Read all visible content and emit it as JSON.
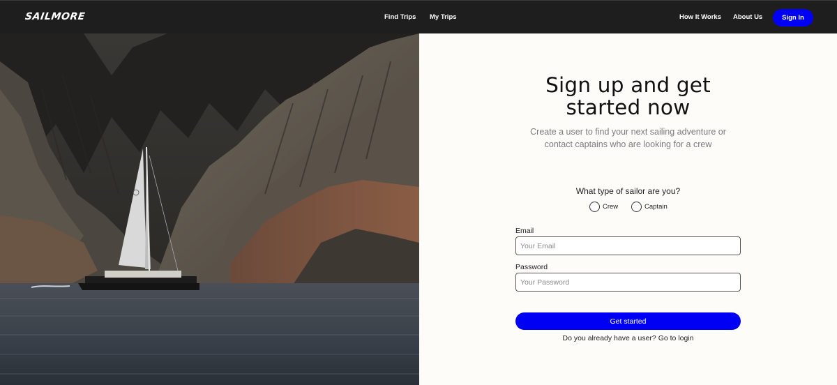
{
  "navbar": {
    "logo": "SAILMORE",
    "links": {
      "find_trips": "Find Trips",
      "my_trips": "My Trips",
      "how_it_works": "How It Works",
      "about_us": "About Us"
    },
    "sign_in": "Sign In"
  },
  "hero": {
    "icon": "sailboat-photo"
  },
  "signup": {
    "heading_line1": "Sign up and get",
    "heading_line2": "started now",
    "subtext_line1": "Create a user to find your next sailing adventure or",
    "subtext_line2": "contact captains who are looking for a crew",
    "sailor_question": "What type of sailor are you?",
    "options": [
      {
        "label": "Crew",
        "checked": false
      },
      {
        "label": "Captain",
        "checked": false
      }
    ],
    "email_label": "Email",
    "email_placeholder": "Your Email",
    "email_value": "",
    "password_label": "Password",
    "password_placeholder": "Your Password",
    "password_value": "",
    "cta": "Get started",
    "login_prompt": "Do you already have a user?",
    "login_link": "Go to login"
  },
  "colors": {
    "navbar_bg": "#1e1e1e",
    "accent": "#0000f5",
    "panel_bg": "#fdfcf8",
    "subtext": "#7b7b7b"
  }
}
